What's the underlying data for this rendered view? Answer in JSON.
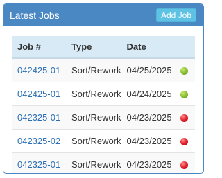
{
  "panel": {
    "title": "Latest Jobs",
    "add_button_label": "Add Job"
  },
  "table": {
    "columns": [
      "Job #",
      "Type",
      "Date",
      ""
    ],
    "rows": [
      {
        "job": "042425-01",
        "type": "Sort/Rework",
        "date": "04/25/2025",
        "status": "green"
      },
      {
        "job": "042425-01",
        "type": "Sort/Rework",
        "date": "04/24/2025",
        "status": "green"
      },
      {
        "job": "042325-01",
        "type": "Sort/Rework",
        "date": "04/23/2025",
        "status": "red"
      },
      {
        "job": "042325-02",
        "type": "Sort/Rework",
        "date": "04/23/2025",
        "status": "red"
      },
      {
        "job": "042325-01",
        "type": "Sort/Rework",
        "date": "04/23/2025",
        "status": "red"
      }
    ]
  },
  "colors": {
    "header_bg": "#4a88c4",
    "button_bg": "#5ec2e4",
    "link": "#2a6fb4",
    "status_green": "#8fc23a",
    "status_red": "#e0202a"
  }
}
